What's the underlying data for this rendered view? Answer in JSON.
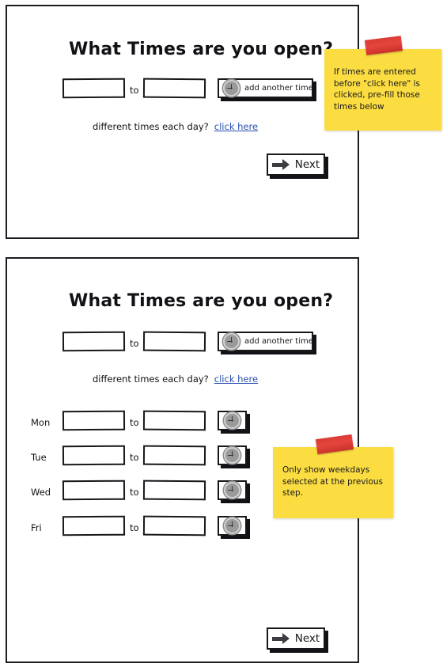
{
  "screens": [
    {
      "id": "screen-basic-hours",
      "title": "What Times are you open?",
      "time_range": {
        "start_value": "",
        "end_value": "",
        "separator_label": "to"
      },
      "add_time_button": {
        "label": "add another time",
        "icon": "plus-circle-icon"
      },
      "hint": {
        "text": "different times each day?",
        "link_label": "click here"
      },
      "next_button": {
        "label": "Next",
        "icon": "arrow-right-icon"
      },
      "note": {
        "text": "If times are entered before \"click here\" is clicked, pre-fill those times below",
        "color": "#fbdd42",
        "tape_color": "#d93a33"
      }
    },
    {
      "id": "screen-per-day-hours",
      "title": "What Times are you open?",
      "time_range": {
        "start_value": "",
        "end_value": "",
        "separator_label": "to"
      },
      "add_time_button": {
        "label": "add another time",
        "icon": "plus-circle-icon"
      },
      "hint": {
        "text": "different times each day?",
        "link_label": "click here"
      },
      "day_rows": [
        {
          "day": "Mon",
          "start_value": "",
          "end_value": "",
          "separator_label": "to",
          "add_icon": "plus-circle-icon"
        },
        {
          "day": "Tue",
          "start_value": "",
          "end_value": "",
          "separator_label": "to",
          "add_icon": "plus-circle-icon"
        },
        {
          "day": "Wed",
          "start_value": "",
          "end_value": "",
          "separator_label": "to",
          "add_icon": "plus-circle-icon"
        },
        {
          "day": "Fri",
          "start_value": "",
          "end_value": "",
          "separator_label": "to",
          "add_icon": "plus-circle-icon"
        }
      ],
      "next_button": {
        "label": "Next",
        "icon": "arrow-right-icon"
      },
      "note": {
        "text": "Only show weekdays selected at the previous step.",
        "color": "#fbdd42",
        "tape_color": "#d93a33"
      }
    }
  ]
}
